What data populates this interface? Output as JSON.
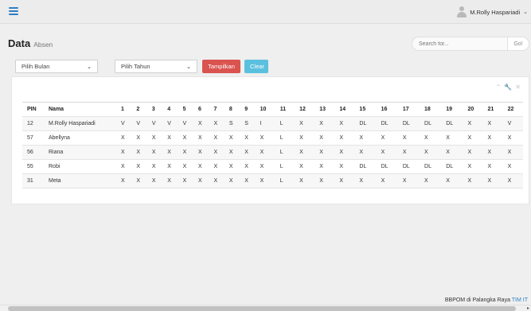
{
  "topbar": {
    "menu_icon": "hamburger-icon",
    "user_name": "M.Rolly Haspariadi",
    "user_icon": "user-avatar-icon",
    "caret": "⌄"
  },
  "page": {
    "title": "Data",
    "subtitle": "Absen"
  },
  "search": {
    "placeholder": "Search for...",
    "button": "Go!"
  },
  "filters": {
    "month_select": "Pilih Bulan",
    "year_select": "Pilih Tahun",
    "show_button": "Tampilkan",
    "clear_button": "Clear"
  },
  "card_tools": {
    "collapse": "⌃",
    "settings": "🔧",
    "close": "✕"
  },
  "table": {
    "headers": [
      "PIN",
      "Nama",
      "1",
      "2",
      "3",
      "4",
      "5",
      "6",
      "7",
      "8",
      "9",
      "10",
      "11",
      "12",
      "13",
      "14",
      "15",
      "16",
      "17",
      "18",
      "19",
      "20",
      "21",
      "22"
    ],
    "rows": [
      [
        "12",
        "M.Rolly Haspariadi",
        "V",
        "V",
        "V",
        "V",
        "V",
        "X",
        "X",
        "S",
        "S",
        "I",
        "L",
        "X",
        "X",
        "X",
        "DL",
        "DL",
        "DL",
        "DL",
        "DL",
        "X",
        "X",
        "V"
      ],
      [
        "57",
        "Abellyna",
        "X",
        "X",
        "X",
        "X",
        "X",
        "X",
        "X",
        "X",
        "X",
        "X",
        "L",
        "X",
        "X",
        "X",
        "X",
        "X",
        "X",
        "X",
        "X",
        "X",
        "X",
        "X"
      ],
      [
        "56",
        "Riana",
        "X",
        "X",
        "X",
        "X",
        "X",
        "X",
        "X",
        "X",
        "X",
        "X",
        "L",
        "X",
        "X",
        "X",
        "X",
        "X",
        "X",
        "X",
        "X",
        "X",
        "X",
        "X"
      ],
      [
        "55",
        "Robi",
        "X",
        "X",
        "X",
        "X",
        "X",
        "X",
        "X",
        "X",
        "X",
        "X",
        "L",
        "X",
        "X",
        "X",
        "DL",
        "DL",
        "DL",
        "DL",
        "DL",
        "X",
        "X",
        "X"
      ],
      [
        "31",
        "Meta",
        "X",
        "X",
        "X",
        "X",
        "X",
        "X",
        "X",
        "X",
        "X",
        "X",
        "L",
        "X",
        "X",
        "X",
        "X",
        "X",
        "X",
        "X",
        "X",
        "X",
        "X",
        "X"
      ]
    ]
  },
  "footer": {
    "text": "BBPOM di Palangka Raya ",
    "accent_text": "TIM IT",
    "accent_color": "#2e7fc2"
  },
  "colors": {
    "primary": "#2e7fc2",
    "danger": "#d9534f",
    "info": "#5bc0de"
  }
}
